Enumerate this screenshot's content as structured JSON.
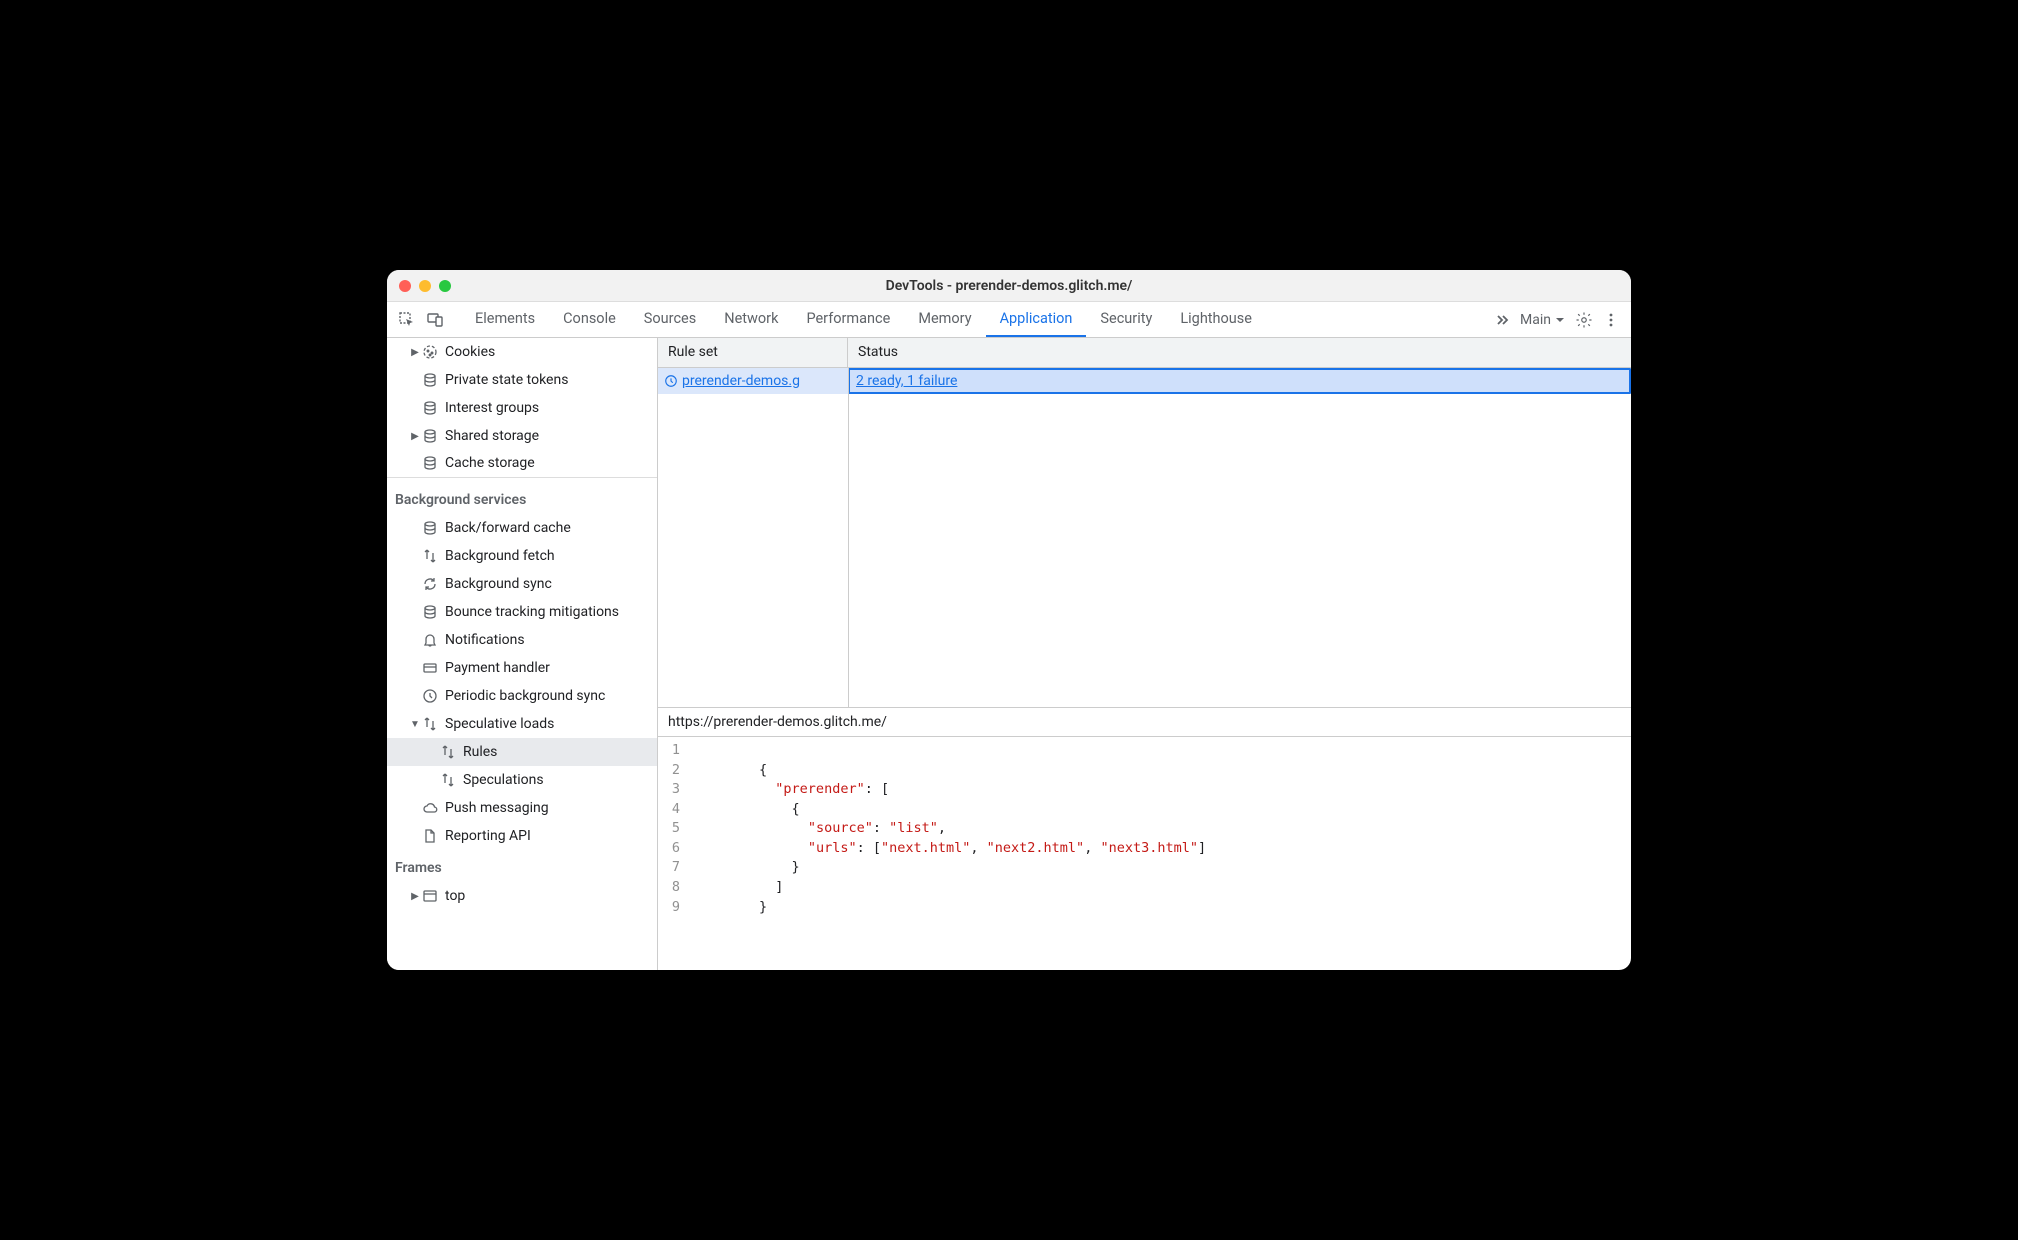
{
  "window": {
    "title": "DevTools - prerender-demos.glitch.me/"
  },
  "tabs": {
    "items": [
      "Elements",
      "Console",
      "Sources",
      "Network",
      "Performance",
      "Memory",
      "Application",
      "Security",
      "Lighthouse"
    ],
    "active": "Application",
    "frame_label": "Main"
  },
  "sidebar": {
    "storage_items": [
      {
        "label": "Cookies",
        "icon": "cookie",
        "expandable": true
      },
      {
        "label": "Private state tokens",
        "icon": "db"
      },
      {
        "label": "Interest groups",
        "icon": "db"
      },
      {
        "label": "Shared storage",
        "icon": "db",
        "expandable": true
      },
      {
        "label": "Cache storage",
        "icon": "db"
      }
    ],
    "bg_header": "Background services",
    "bg_items": [
      {
        "label": "Back/forward cache",
        "icon": "db"
      },
      {
        "label": "Background fetch",
        "icon": "arrows"
      },
      {
        "label": "Background sync",
        "icon": "sync"
      },
      {
        "label": "Bounce tracking mitigations",
        "icon": "db"
      },
      {
        "label": "Notifications",
        "icon": "bell"
      },
      {
        "label": "Payment handler",
        "icon": "card"
      },
      {
        "label": "Periodic background sync",
        "icon": "clock"
      },
      {
        "label": "Speculative loads",
        "icon": "arrows",
        "expanded": true,
        "children": [
          {
            "label": "Rules",
            "icon": "arrows",
            "selected": true
          },
          {
            "label": "Speculations",
            "icon": "arrows"
          }
        ]
      },
      {
        "label": "Push messaging",
        "icon": "cloud"
      },
      {
        "label": "Reporting API",
        "icon": "doc"
      }
    ],
    "frames_header": "Frames",
    "frames_items": [
      {
        "label": "top",
        "icon": "frame",
        "expandable": true
      }
    ]
  },
  "table": {
    "cols": [
      "Rule set",
      "Status"
    ],
    "rows": [
      {
        "ruleset": "prerender-demos.g",
        "status": "2 ready, 1 failure"
      }
    ]
  },
  "detail": {
    "url": "https://prerender-demos.glitch.me/",
    "code_lines": [
      [
        {
          "t": "punc",
          "v": ""
        }
      ],
      [
        {
          "t": "punc",
          "v": "{"
        }
      ],
      [
        {
          "t": "punc",
          "v": "  "
        },
        {
          "t": "key",
          "v": "\"prerender\""
        },
        {
          "t": "punc",
          "v": ": ["
        }
      ],
      [
        {
          "t": "punc",
          "v": "    {"
        }
      ],
      [
        {
          "t": "punc",
          "v": "      "
        },
        {
          "t": "key",
          "v": "\"source\""
        },
        {
          "t": "punc",
          "v": ": "
        },
        {
          "t": "str",
          "v": "\"list\""
        },
        {
          "t": "punc",
          "v": ","
        }
      ],
      [
        {
          "t": "punc",
          "v": "      "
        },
        {
          "t": "key",
          "v": "\"urls\""
        },
        {
          "t": "punc",
          "v": ": ["
        },
        {
          "t": "str",
          "v": "\"next.html\""
        },
        {
          "t": "punc",
          "v": ", "
        },
        {
          "t": "str",
          "v": "\"next2.html\""
        },
        {
          "t": "punc",
          "v": ", "
        },
        {
          "t": "str",
          "v": "\"next3.html\""
        },
        {
          "t": "punc",
          "v": "]"
        }
      ],
      [
        {
          "t": "punc",
          "v": "    }"
        }
      ],
      [
        {
          "t": "punc",
          "v": "  ]"
        }
      ],
      [
        {
          "t": "punc",
          "v": "}"
        }
      ]
    ]
  }
}
